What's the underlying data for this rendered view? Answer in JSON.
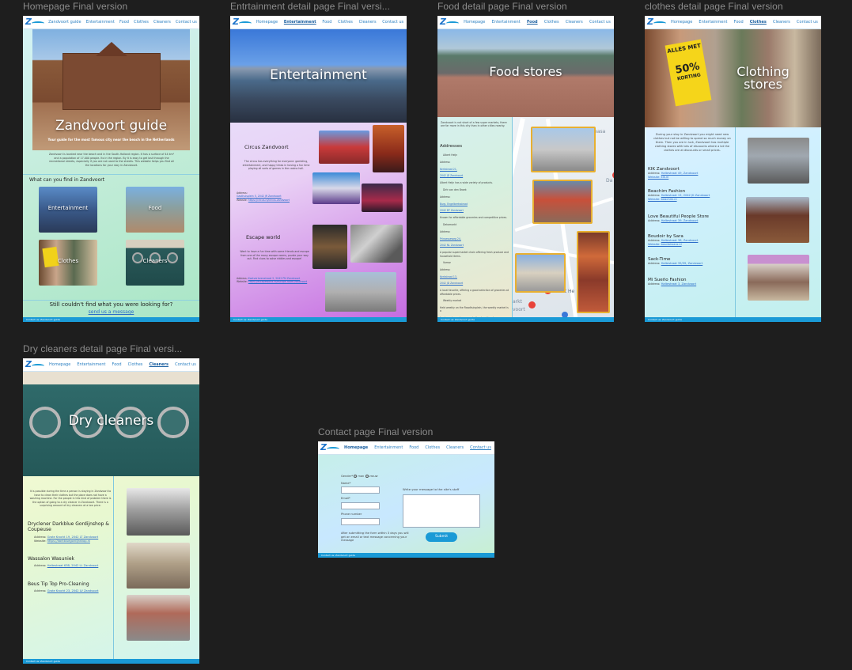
{
  "labels": {
    "home": "Homepage Final version",
    "ent": "Entrtainment detail page Final versi...",
    "food": "Food detail page Final version",
    "clothes": "clothes detail page Final version",
    "dry": "Dry cleaners detail page Final versi...",
    "contact": "Contact page Final version"
  },
  "nav": {
    "home": "Homepage",
    "ent": "Entertainment",
    "food": "Food",
    "clothes": "Clothes",
    "cleaners": "Cleaners",
    "contact": "Contact us"
  },
  "home": {
    "title": "Zandvoort guide",
    "subtitle": "Your guide for the most famous city near the beach in the Netherlands",
    "intro": "Zandvoort is located near the beach and in the South-Holland region. It has a surface of 44 km² and a population of 17.000 people. Its in the region. By it is easy to get lost through the recreational streets, especially if you are not used to the streets. This website helps you find all the locations for your stay in Zandvoort.",
    "find_heading": "What can you find in Zandvoort",
    "tiles": [
      "Entertainment",
      "Food",
      "Clothes",
      "Cleaners"
    ],
    "still": "Still couldn't find what you were looking for?",
    "send": "send us a message"
  },
  "ent": {
    "title": "Entertainment",
    "circus": "Circus Zandvoort",
    "circus_text": "The circus has everything for everyone: gambling, entertainment, and happy times in having a fun time playing all sorts of games in the casino hall.",
    "circus_addr": "Address:",
    "circus_addr_val": "Gasthuisplein 5, 2042 JR Zandvoort",
    "circus_site": "Website:",
    "circus_site_val": "https://circus.nl/circus-zandvoort",
    "escape": "Escape world",
    "escape_text": "Want to have a fun time with some friends and escape from one of the many escape rooms, puzzle your way out. Find clues to solve riddles and escape!",
    "escape_addr_val": "Kostverlorenstraat 2, 2042 PN Zandvoort",
    "escape_site_val": "https://escapeworld.nl/escape-room-zandvoort"
  },
  "food": {
    "title": "Food stores",
    "intro": "Zandvoort is not short of a few super markets, there are far more in this city than in other cities nearby.",
    "addresses": "Addresses",
    "items": [
      "Albert Heijn",
      "Address:",
      "Kerkstraat 21,",
      "2042 JD Zandvoort",
      "Albert Heijn has a wide variety of products.",
      "Dirk van den Broek",
      "Address:",
      "Burg. Engelbertsstraat",
      "2042 BT Zandvoort",
      "Known for affordable groceries and competitive prices.",
      "Dekamarkt",
      "Address:",
      "Prinsesseweg 24,",
      "2042 NL Zandvoort",
      "A popular supermarket chain offering fresh produce and household items.",
      "Vomar",
      "Address:",
      "Kerkstraat 13,",
      "2042 JD Zandvoort",
      "A local favorite, offering a good selection of groceries at affordable prices.",
      "Weekly market",
      "Held weekly on the Raadhuisplein, the weekly market is a",
      "fresh produce, cheese, and other local treats."
    ],
    "map_labels": [
      "Albert He",
      "arkt",
      "voort",
      "seasa",
      "Da"
    ]
  },
  "clothes": {
    "title": "Clothing stores",
    "sign": "ALLES MET",
    "sign_pct": "50%",
    "sign_off": "KORTING",
    "intro": "During your stay in Zandvoort you might need new clothes but not be willing to spend so much money on them. Then you are in luck, Zandvoort has multiple clothing stores with lots of discounts where a lot the clothes are at discounts or small prices.",
    "stores": [
      {
        "name": "KIK Zandvoort",
        "addr": "Haltestraat 49, Zandvoort",
        "site": "Website: kik.nl"
      },
      {
        "name": "Beachim Fashion",
        "addr": "Haltestraat 15, 2042 JK Zandvoort",
        "site": "Website: beachim.nl"
      },
      {
        "name": "Love Beautiful People Store",
        "addr": "Haltestraat 39, Zandvoort",
        "site": ""
      },
      {
        "name": "Boudoir by Sara",
        "addr": "Haltestraat 38, Zandvoort",
        "site": "Website: boudoirsara.nl"
      },
      {
        "name": "Sack-Time",
        "addr": "Haltestraat 35/39, Zandvoort",
        "site": ""
      },
      {
        "name": "Mi Sueño Fashion",
        "addr": "Haltestraat 3, Zandvoort",
        "site": ""
      }
    ]
  },
  "dry": {
    "title": "Dry cleaners",
    "intro": "It is possible during the time a person is staying in Zandvoort to have to clean their clothes but the place does not have a washing machine. For the people in this kind of problem there is the option of going to a dry cleaner in Zandvoort. There is a surprising amount of dry cleaners at a low price.",
    "shops": [
      {
        "name": "Dryclener Darkblue Gordijnshop & Coupeuse",
        "addr": "Grote Krocht 19, 2042 LT Zandvoort",
        "site": "https://darkbluegordijnshop.nl"
      },
      {
        "name": "Wassalon Wasuniek",
        "addr": "Haltestraat 63B, 2042 LL Zandvoort",
        "site": ""
      },
      {
        "name": "Beus Tip Top Pro-Cleaning",
        "addr": "Grote Krocht 23, 2042 LV Zandvoort",
        "site": ""
      }
    ],
    "addr_label": "Address:",
    "site_label": "Website:"
  },
  "contact": {
    "gender": "Gender*",
    "male": "man",
    "female": "vrouw",
    "name": "Name*",
    "email": "Email*",
    "phone": "Phone number",
    "message": "Write your message to the site's staff",
    "note": "After submitting the form within 3 days you will get an email or text message concerning your message",
    "submit": "Submit"
  },
  "footer": "Contact us: Zandvoort guide"
}
